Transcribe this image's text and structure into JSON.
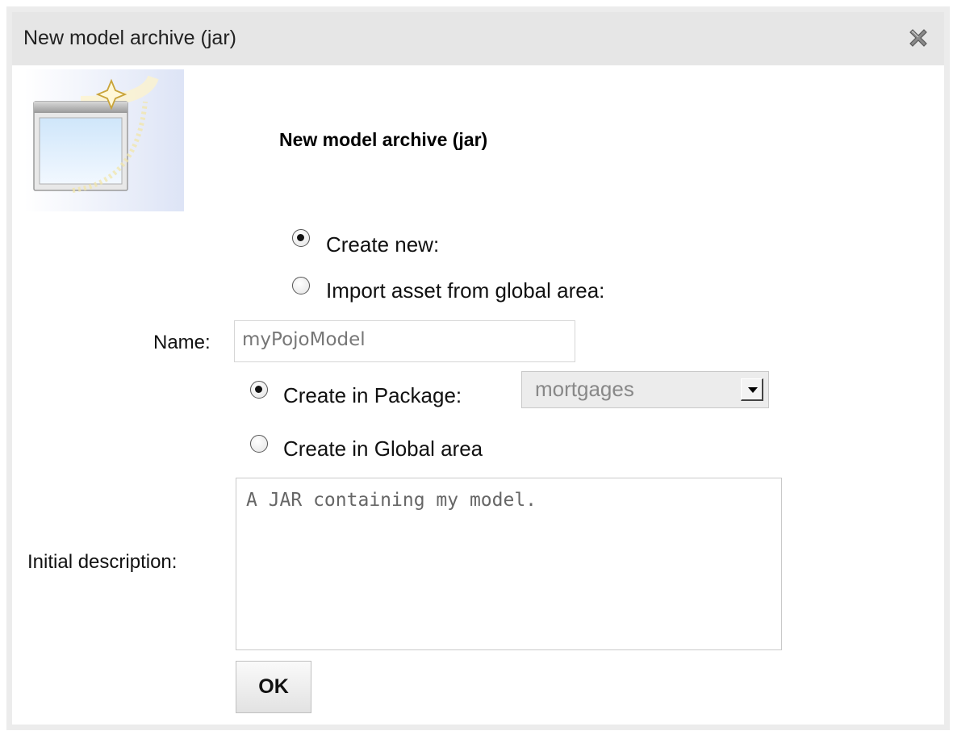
{
  "dialog": {
    "title": "New model archive (jar)",
    "heading": "New model archive (jar)",
    "close_icon": "close-icon"
  },
  "source": {
    "create_new_label": "Create new:",
    "create_new_checked": true,
    "import_label": "Import asset from global area:",
    "import_checked": false
  },
  "name_field": {
    "label": "Name:",
    "value": "myPojoModel"
  },
  "location": {
    "package_label": "Create in Package:",
    "package_checked": true,
    "package_selected": "mortgages",
    "global_label": "Create in Global area",
    "global_checked": false
  },
  "description": {
    "label": "Initial description:",
    "value": "A JAR containing my model."
  },
  "ok_label": "OK",
  "icons": {
    "wizard": "new-wizard-icon",
    "close": "close-icon"
  }
}
